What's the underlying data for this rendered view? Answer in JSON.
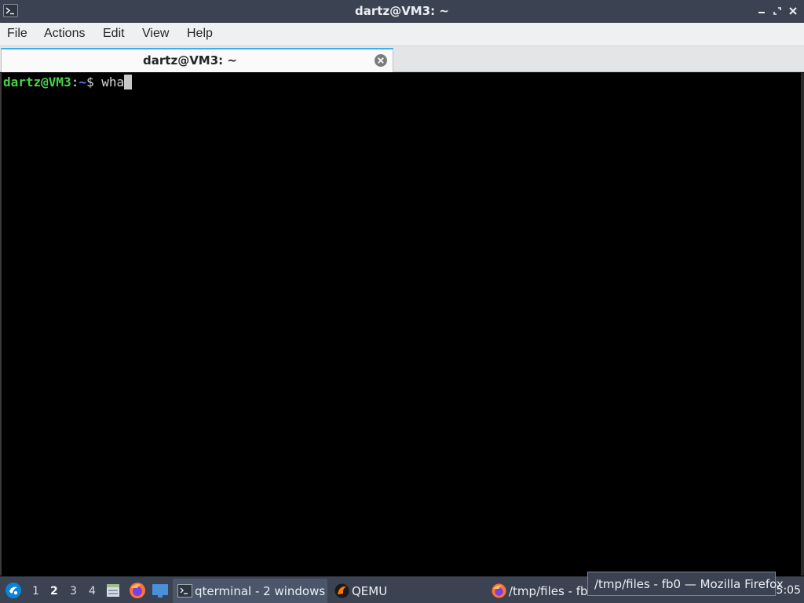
{
  "window": {
    "title": "dartz@VM3: ~"
  },
  "menubar": {
    "items": [
      "File",
      "Actions",
      "Edit",
      "View",
      "Help"
    ]
  },
  "tabs": [
    {
      "label": "dartz@VM3: ~"
    }
  ],
  "terminal": {
    "prompt_user": "dartz@VM3",
    "prompt_colon": ":",
    "prompt_path": "~",
    "prompt_dollar": "$ ",
    "command": "wha"
  },
  "taskbar": {
    "workspaces": [
      "1",
      "2",
      "3",
      "4"
    ],
    "active_workspace": "2",
    "tasks": [
      {
        "label": "qterminal - 2 windows",
        "icon": "terminal-icon"
      },
      {
        "label": "QEMU",
        "icon": "qemu-icon"
      },
      {
        "label": "/tmp/files - fb0",
        "icon": "firefox-icon"
      }
    ],
    "clock": "5:05"
  },
  "tooltip": {
    "text": "/tmp/files - fb0 — Mozilla Firefox"
  },
  "colors": {
    "titlebar_bg": "#3b4252",
    "menubar_bg": "#eff0f1",
    "terminal_bg": "#000000",
    "prompt_user": "#4ad24a",
    "prompt_path": "#5b7df5",
    "tab_accent": "#3daee9"
  }
}
